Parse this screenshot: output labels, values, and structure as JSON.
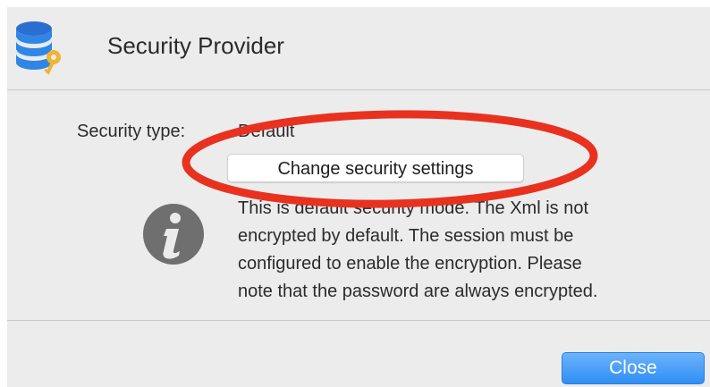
{
  "dialog": {
    "title": "Security Provider",
    "icon": "database-key-icon"
  },
  "security": {
    "type_label": "Security type:",
    "type_value": "Default",
    "change_button_label": "Change security settings"
  },
  "info": {
    "icon": "info-icon",
    "lines": [
      "This is default security mode. The Xml is not",
      "encrypted by default. The session must be",
      "configured to enable the encryption. Please",
      "note that the password are always encrypted."
    ]
  },
  "footer": {
    "close_button_label": "Close"
  },
  "colors": {
    "background": "#ececec",
    "accent_button": "#2f8ef5",
    "annotation_red": "#e8321f"
  }
}
